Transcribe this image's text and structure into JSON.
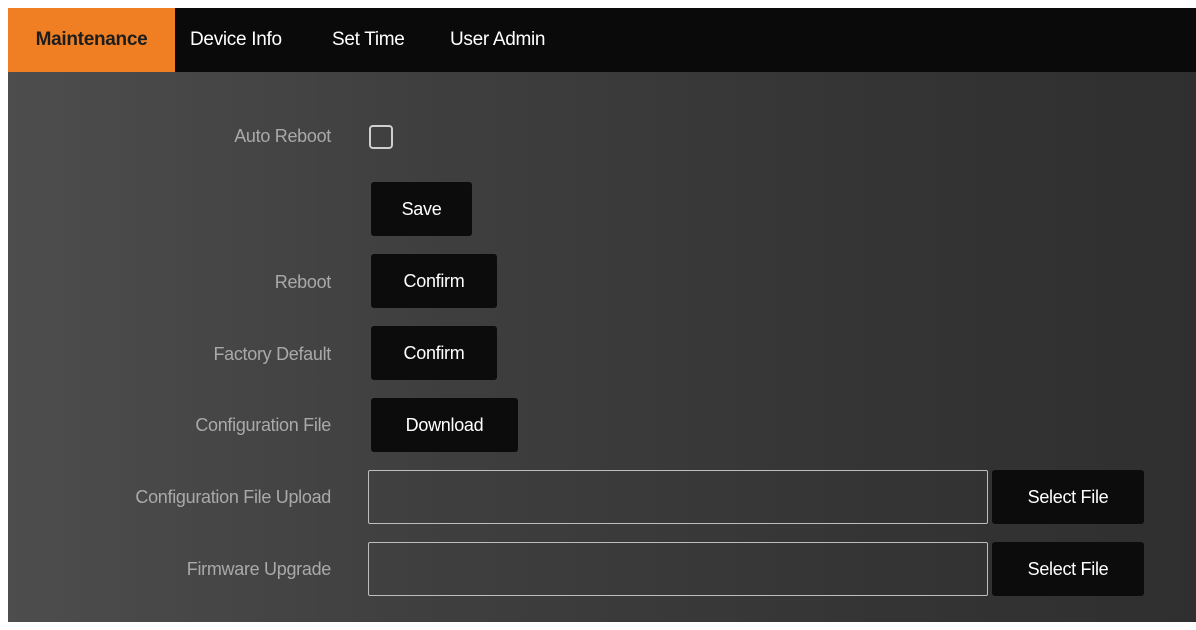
{
  "tabs": [
    {
      "label": "Maintenance",
      "active": true
    },
    {
      "label": "Device Info",
      "active": false
    },
    {
      "label": "Set Time",
      "active": false
    },
    {
      "label": "User Admin",
      "active": false
    }
  ],
  "colors": {
    "accent": "#ef7f22",
    "tabbar_bg": "#0a0a0a",
    "button_bg": "#0c0c0c",
    "label_text": "#a9a9a9"
  },
  "maintenance": {
    "auto_reboot": {
      "label": "Auto Reboot",
      "checked": false
    },
    "save_button": "Save",
    "reboot": {
      "label": "Reboot",
      "button": "Confirm"
    },
    "factory_default": {
      "label": "Factory Default",
      "button": "Confirm"
    },
    "configuration_file": {
      "label": "Configuration File",
      "button": "Download"
    },
    "configuration_file_upload": {
      "label": "Configuration File Upload",
      "value": "",
      "button": "Select File"
    },
    "firmware_upgrade": {
      "label": "Firmware Upgrade",
      "value": "",
      "button": "Select File"
    }
  }
}
